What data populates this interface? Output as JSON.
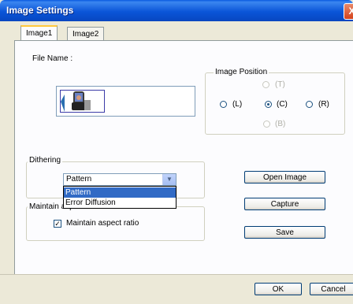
{
  "window": {
    "title": "Image Settings",
    "close_label": "X"
  },
  "tabs": [
    {
      "label": "Image1",
      "active": true
    },
    {
      "label": "Image2",
      "active": false
    }
  ],
  "file_name_label": "File Name :",
  "image_position": {
    "title": "Image Position",
    "options": [
      {
        "label": "(T)",
        "checked": false,
        "enabled": false
      },
      {
        "label": "(L)",
        "checked": false,
        "enabled": true
      },
      {
        "label": "(C)",
        "checked": true,
        "enabled": true
      },
      {
        "label": "(R)",
        "checked": false,
        "enabled": true
      },
      {
        "label": "(B)",
        "checked": false,
        "enabled": false
      }
    ]
  },
  "dithering": {
    "title": "Dithering",
    "selected": "Pattern",
    "options": [
      "Pattern",
      "Error Diffusion"
    ]
  },
  "maintain": {
    "title": "Maintain aspect ratio",
    "checkbox_label": "Maintain aspect ratio",
    "checkbox_mark": "✓",
    "checked": true
  },
  "buttons": {
    "open_image": "Open Image",
    "capture": "Capture",
    "save": "Save",
    "ok": "OK",
    "cancel": "Cancel"
  },
  "colors": {
    "title_bar": "#0a55d8",
    "selection": "#316ac5",
    "close_button": "#d4421c"
  }
}
